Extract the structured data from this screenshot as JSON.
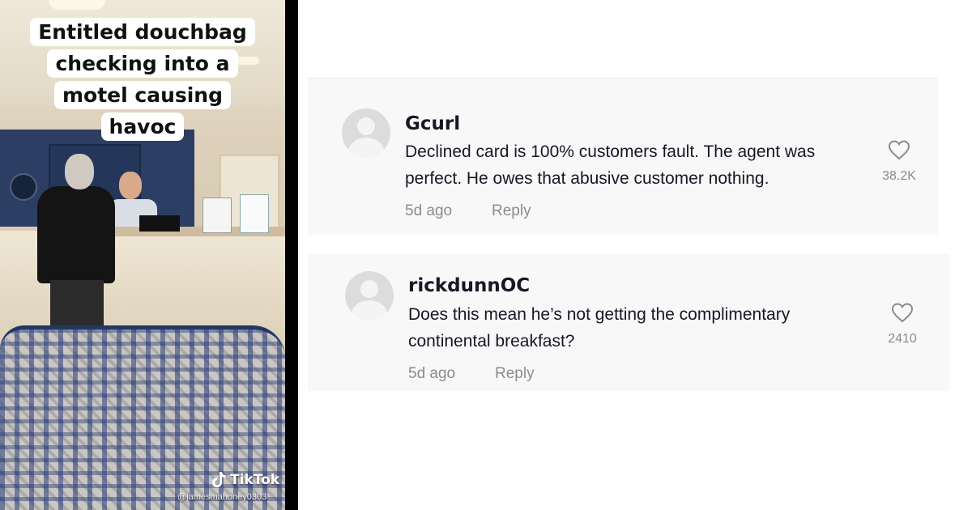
{
  "video": {
    "caption_lines": [
      "Entitled douchbag",
      "checking into a",
      "motel causing",
      "havoc"
    ],
    "platform_label": "TikTok",
    "handle": "@jamesmahoney0303"
  },
  "comments": [
    {
      "username": "Gcurl",
      "text_lines": [
        "Declined card is 100% customers fault. The agent was",
        "perfect. He owes that abusive customer nothing."
      ],
      "time": "5d ago",
      "reply_label": "Reply",
      "likes": "38.2K",
      "like_icon": "heart-outline-icon"
    },
    {
      "username": "rickdunnOC",
      "text_lines": [
        "Does this mean he’s not getting the complimentary",
        "continental breakfast?"
      ],
      "time": "5d ago",
      "reply_label": "Reply",
      "likes": "2410",
      "like_icon": "heart-outline-icon"
    }
  ],
  "colors": {
    "text": "#161823",
    "muted": "#8a8b91",
    "comment_bg": "#f8f8f8"
  }
}
